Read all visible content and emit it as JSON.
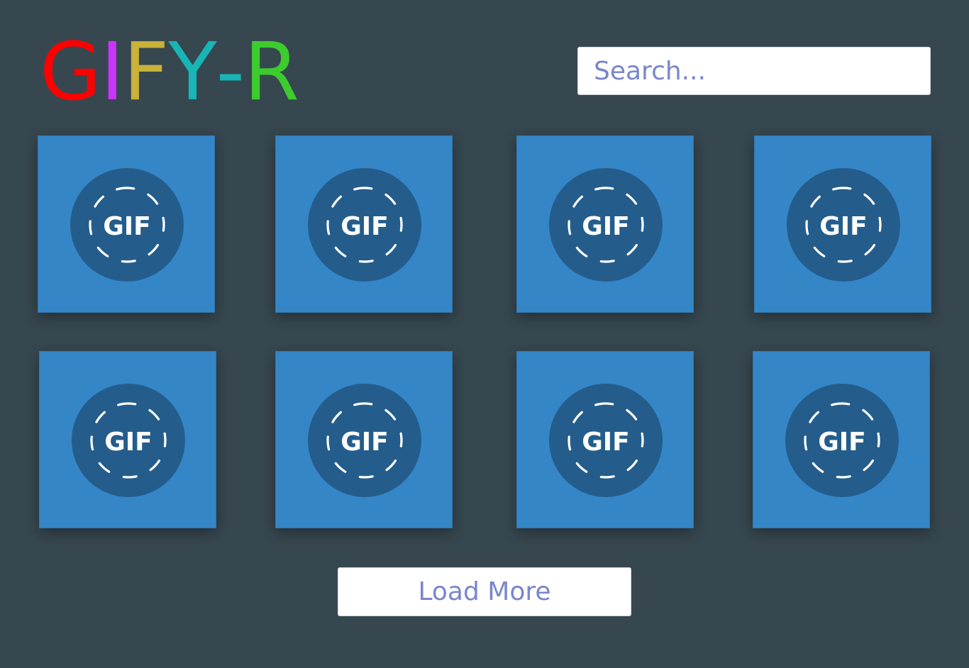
{
  "logo": {
    "letters": [
      {
        "char": "G",
        "color": "#ff0000"
      },
      {
        "char": "I",
        "color": "#cc33ff"
      },
      {
        "char": "F",
        "color": "#c9b13a"
      },
      {
        "char": "Y",
        "color": "#17b5b5"
      },
      {
        "char": "-",
        "color": "#17b5b5"
      },
      {
        "char": "R",
        "color": "#3ccc2e"
      }
    ]
  },
  "search": {
    "placeholder": "Search...",
    "value": ""
  },
  "grid": {
    "items": [
      {
        "label": "GIF"
      },
      {
        "label": "GIF"
      },
      {
        "label": "GIF"
      },
      {
        "label": "GIF"
      },
      {
        "label": "GIF"
      },
      {
        "label": "GIF"
      },
      {
        "label": "GIF"
      },
      {
        "label": "GIF"
      }
    ],
    "icon": "gif-placeholder-icon"
  },
  "load_more": {
    "label": "Load More"
  },
  "colors": {
    "background": "#37474f",
    "tile": "#3586c7",
    "badge": "#245d8c",
    "accent_text": "#7986cb"
  }
}
